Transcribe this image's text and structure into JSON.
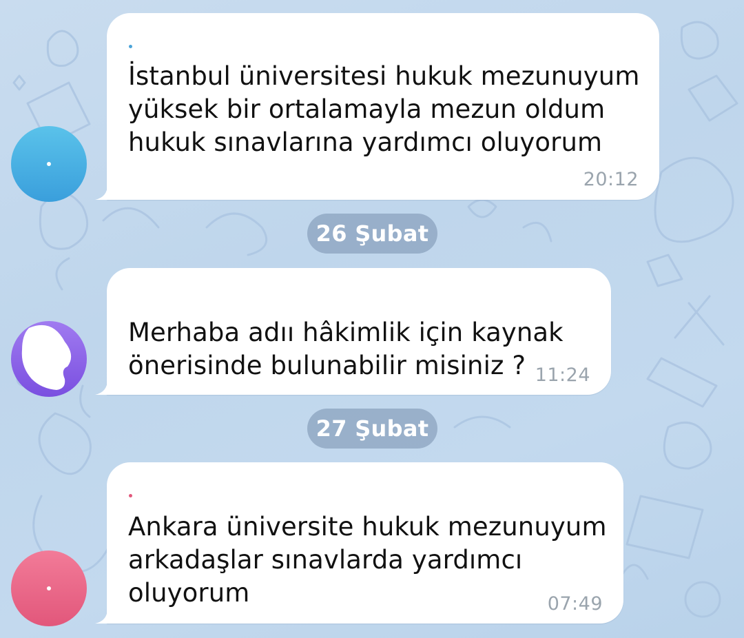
{
  "colors": {
    "wallpaper": "#c3d9ee",
    "bubble": "#ffffff",
    "time_text": "#9aa4ad",
    "date_pill": "#8098b4",
    "avatar_1": "#3fa8e0",
    "avatar_2": "#8a5fe6",
    "avatar_3": "#ea6384",
    "sender_dot_1": "#4aa3d8",
    "sender_dot_3": "#e2577b"
  },
  "messages": [
    {
      "avatar_icon": "blue-avatar",
      "text": "İstanbul üniversitesi hukuk mezunuyum\nyüksek bir ortalamayla mezun oldum\nhukuk sınavlarına yardımcı oluyorum",
      "time": "20:12"
    },
    {
      "avatar_icon": "purple-avatar-redacted",
      "text": "Merhaba adıı hâkimlik için kaynak\nönerisinde bulunabilir misiniz ?",
      "time": "11:24"
    },
    {
      "avatar_icon": "pink-avatar",
      "text": "Ankara üniversite hukuk mezunuyum\narkadaşlar sınavlarda yardımcı\noluyorum",
      "time": "07:49"
    }
  ],
  "date_separators": [
    {
      "label": "26 Şubat"
    },
    {
      "label": "27 Şubat"
    }
  ]
}
